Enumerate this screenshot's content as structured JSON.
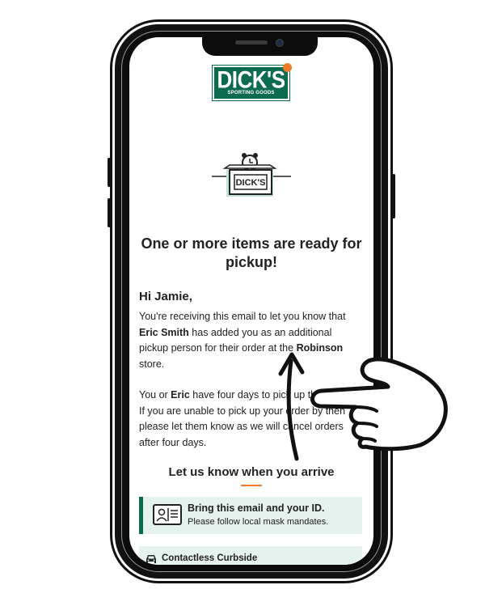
{
  "brand": {
    "logo_main": "DICK'S",
    "logo_sub": "SPORTING GOODS",
    "badge_text": "DICK'S",
    "green": "#0b6b4e",
    "orange": "#ee7b2c"
  },
  "email": {
    "title": "One or more items are ready for pickup!",
    "greeting": "Hi Jamie,",
    "paragraph1": {
      "intro": "You're receiving this email to let you know that ",
      "sender": "Eric Smith",
      "middle": " has added you as an additional pickup person for their order at the ",
      "store": "Robinson",
      "end": " store."
    },
    "paragraph2": {
      "start": "You or ",
      "sender_first": "Eric",
      "end": " have four days to pick up the item(s). If you are unable to pick up your order by then please let them know as we will cancel orders after four days."
    },
    "section_heading": "Let us know when you arrive",
    "id_notice": {
      "title": "Bring this email and your ID.",
      "subtitle": "Please follow local mask mandates.",
      "icon": "id-card-icon"
    },
    "curbside": {
      "label": "Contactless Curbside",
      "icon": "car-icon"
    }
  },
  "overlay": {
    "icons": [
      "pointing-hand-icon",
      "curved-arrow-icon"
    ]
  }
}
